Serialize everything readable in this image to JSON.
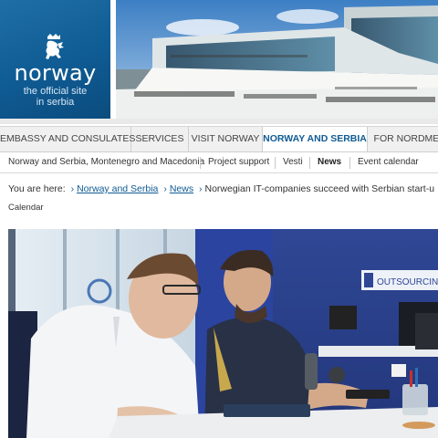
{
  "header": {
    "logo_word": "norway",
    "logo_subtitle_line1": "the official site",
    "logo_subtitle_line2": "in serbia"
  },
  "main_nav": {
    "tabs": [
      {
        "label": "EMBASSY AND CONSULATES",
        "active": false
      },
      {
        "label": "SERVICES",
        "active": false
      },
      {
        "label": "VISIT NORWAY",
        "active": false
      },
      {
        "label": "NORWAY AND SERBIA",
        "active": true
      },
      {
        "label": "FOR NORDMENN",
        "active": false
      }
    ]
  },
  "sub_nav": {
    "items": [
      {
        "label": "Norway and Serbia, Montenegro and Macedonia",
        "active": false
      },
      {
        "label": "Project support",
        "active": false
      },
      {
        "label": "Vesti",
        "active": false
      },
      {
        "label": "News",
        "active": true
      },
      {
        "label": "Event calendar",
        "active": false
      }
    ]
  },
  "breadcrumb": {
    "prefix": "You are here:",
    "links": [
      "Norway and Serbia",
      "News"
    ],
    "current": "Norwegian IT-companies succeed with Serbian start-u"
  },
  "calendar_label": "Calendar",
  "photo": {
    "wall_sign_text": "OUTSOURCING"
  },
  "colors": {
    "brand_blue": "#0f5b93",
    "nav_background": "#f0f0f0",
    "office_wall": "#2a3f86"
  }
}
